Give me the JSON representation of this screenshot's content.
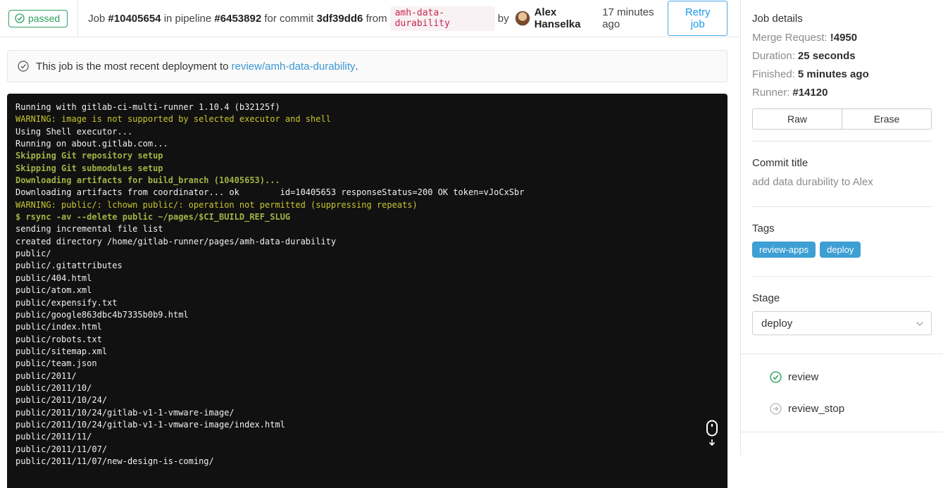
{
  "header": {
    "status_label": "passed",
    "job_label": "Job",
    "job_id": "#10405654",
    "in_pipeline": "in pipeline",
    "pipeline_id": "#6453892",
    "for_commit": "for commit",
    "commit_sha": "3df39dd6",
    "from_label": "from",
    "ref": "amh-data-durability",
    "by_label": "by",
    "author": "Alex Hanselka",
    "time_ago": "17 minutes ago",
    "retry_label": "Retry job"
  },
  "notice": {
    "text": "This job is the most recent deployment to",
    "link": "review/amh-data-durability",
    "suffix": "."
  },
  "log": {
    "lines": [
      {
        "t": "Running with gitlab-ci-multi-runner 1.10.4 (b32125f)",
        "s": "plain"
      },
      {
        "t": "WARNING: image is not supported by selected executor and shell",
        "s": "warn"
      },
      {
        "t": "Using Shell executor...",
        "s": "plain"
      },
      {
        "t": "Running on about.gitlab.com...",
        "s": "plain"
      },
      {
        "t": "Skipping Git repository setup",
        "s": "notice"
      },
      {
        "t": "Skipping Git submodules setup",
        "s": "notice"
      },
      {
        "t": "Downloading artifacts for build_branch (10405653)...",
        "s": "notice"
      },
      {
        "t": "Downloading artifacts from coordinator... ok        id=10405653 responseStatus=200 OK token=vJoCxSbr",
        "s": "plain"
      },
      {
        "t": "WARNING: public/: lchown public/: operation not permitted (suppressing repeats)",
        "s": "warn"
      },
      {
        "t": "$ rsync -av --delete public ~/pages/$CI_BUILD_REF_SLUG",
        "s": "cmd"
      },
      {
        "t": "sending incremental file list",
        "s": "plain"
      },
      {
        "t": "created directory /home/gitlab-runner/pages/amh-data-durability",
        "s": "plain"
      },
      {
        "t": "public/",
        "s": "plain"
      },
      {
        "t": "public/.gitattributes",
        "s": "plain"
      },
      {
        "t": "public/404.html",
        "s": "plain"
      },
      {
        "t": "public/atom.xml",
        "s": "plain"
      },
      {
        "t": "public/expensify.txt",
        "s": "plain"
      },
      {
        "t": "public/google863dbc4b7335b0b9.html",
        "s": "plain"
      },
      {
        "t": "public/index.html",
        "s": "plain"
      },
      {
        "t": "public/robots.txt",
        "s": "plain"
      },
      {
        "t": "public/sitemap.xml",
        "s": "plain"
      },
      {
        "t": "public/team.json",
        "s": "plain"
      },
      {
        "t": "public/2011/",
        "s": "plain"
      },
      {
        "t": "public/2011/10/",
        "s": "plain"
      },
      {
        "t": "public/2011/10/24/",
        "s": "plain"
      },
      {
        "t": "public/2011/10/24/gitlab-v1-1-vmware-image/",
        "s": "plain"
      },
      {
        "t": "public/2011/10/24/gitlab-v1-1-vmware-image/index.html",
        "s": "plain"
      },
      {
        "t": "public/2011/11/",
        "s": "plain"
      },
      {
        "t": "public/2011/11/07/",
        "s": "plain"
      },
      {
        "t": "public/2011/11/07/new-design-is-coming/",
        "s": "plain"
      }
    ]
  },
  "sidebar": {
    "job_details_title": "Job details",
    "details": [
      {
        "label": "Merge Request:",
        "value": "!4950"
      },
      {
        "label": "Duration:",
        "value": "25 seconds"
      },
      {
        "label": "Finished:",
        "value": "5 minutes ago"
      },
      {
        "label": "Runner:",
        "value": "#14120"
      }
    ],
    "buttons": [
      "Raw",
      "Erase"
    ],
    "commit_title_heading": "Commit title",
    "commit_title": "add data durability to Alex",
    "tags_heading": "Tags",
    "tags": [
      "review-apps",
      "deploy"
    ],
    "stage_heading": "Stage",
    "stage_selected": "deploy",
    "jobs": [
      {
        "name": "review",
        "status": "passed"
      },
      {
        "name": "review_stop",
        "status": "manual"
      }
    ]
  },
  "colors": {
    "status_green": "#2da160",
    "link_blue": "#3b97d3",
    "tag_blue": "#3d9fd4",
    "ref_pink": "#c7254e",
    "warning_yellow": "#c6c632",
    "command_green": "#a3b245"
  }
}
